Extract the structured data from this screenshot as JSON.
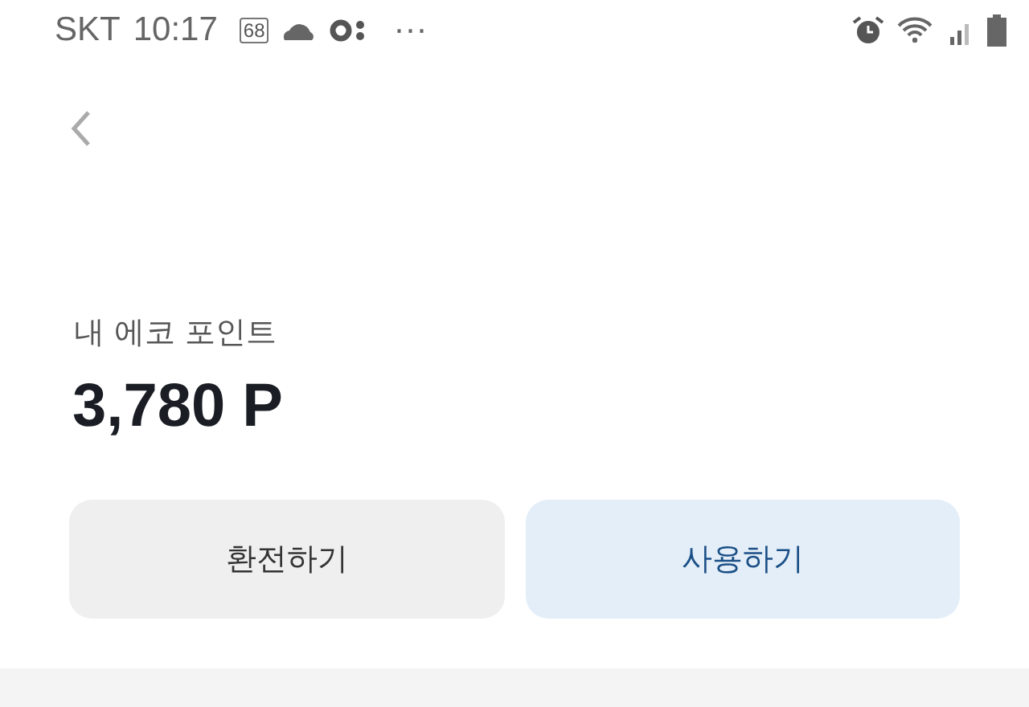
{
  "status_bar": {
    "carrier": "SKT",
    "time": "10:17",
    "badge": "68",
    "more": "···"
  },
  "points": {
    "label": "내 에코 포인트",
    "value": "3,780 P"
  },
  "buttons": [
    {
      "label": "환전하기",
      "kind": "secondary"
    },
    {
      "label": "사용하기",
      "kind": "primary"
    }
  ]
}
